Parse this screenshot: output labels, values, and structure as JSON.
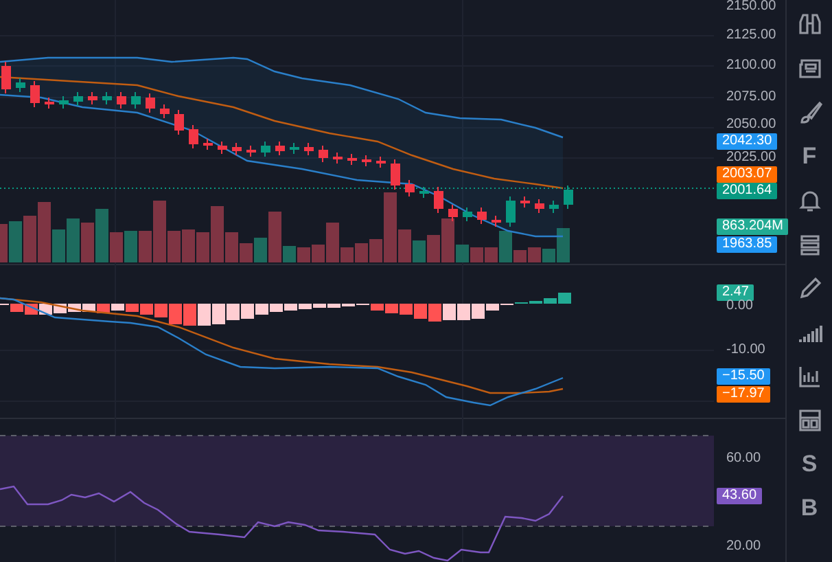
{
  "panes": [
    {
      "axis": [
        {
          "kind": "tick",
          "label": "2150.00"
        },
        {
          "kind": "tick",
          "label": "2125.00"
        },
        {
          "kind": "tick",
          "label": "2100.00"
        },
        {
          "kind": "tick",
          "label": "2075.00"
        },
        {
          "kind": "tick",
          "label": "2050.00"
        },
        {
          "kind": "tag",
          "label": "2042.30",
          "color": "#2196f3"
        },
        {
          "kind": "tick",
          "label": "2025.00"
        },
        {
          "kind": "tag",
          "label": "2003.07",
          "color": "#ff6d00"
        },
        {
          "kind": "tag",
          "label": "2001.64",
          "color": "#089981"
        },
        {
          "kind": "tag",
          "label": "863.204M",
          "color": "#22ab94"
        },
        {
          "kind": "tag",
          "label": "1963.85",
          "color": "#2196f3"
        }
      ]
    },
    {
      "axis": [
        {
          "kind": "tag",
          "label": "2.47",
          "color": "#22ab94"
        },
        {
          "kind": "tick",
          "label": "0.00"
        },
        {
          "kind": "tick",
          "label": "-10.00"
        },
        {
          "kind": "tag",
          "label": "−15.50",
          "color": "#2196f3"
        },
        {
          "kind": "tag",
          "label": "−17.97",
          "color": "#ff6d00"
        }
      ]
    },
    {
      "axis": [
        {
          "kind": "tick",
          "label": "60.00"
        },
        {
          "kind": "tag",
          "label": "43.60",
          "color": "#7e57c2"
        },
        {
          "kind": "tick",
          "label": "20.00"
        }
      ]
    }
  ],
  "toolbar": {
    "letters": [
      "F",
      "S",
      "B"
    ]
  }
}
